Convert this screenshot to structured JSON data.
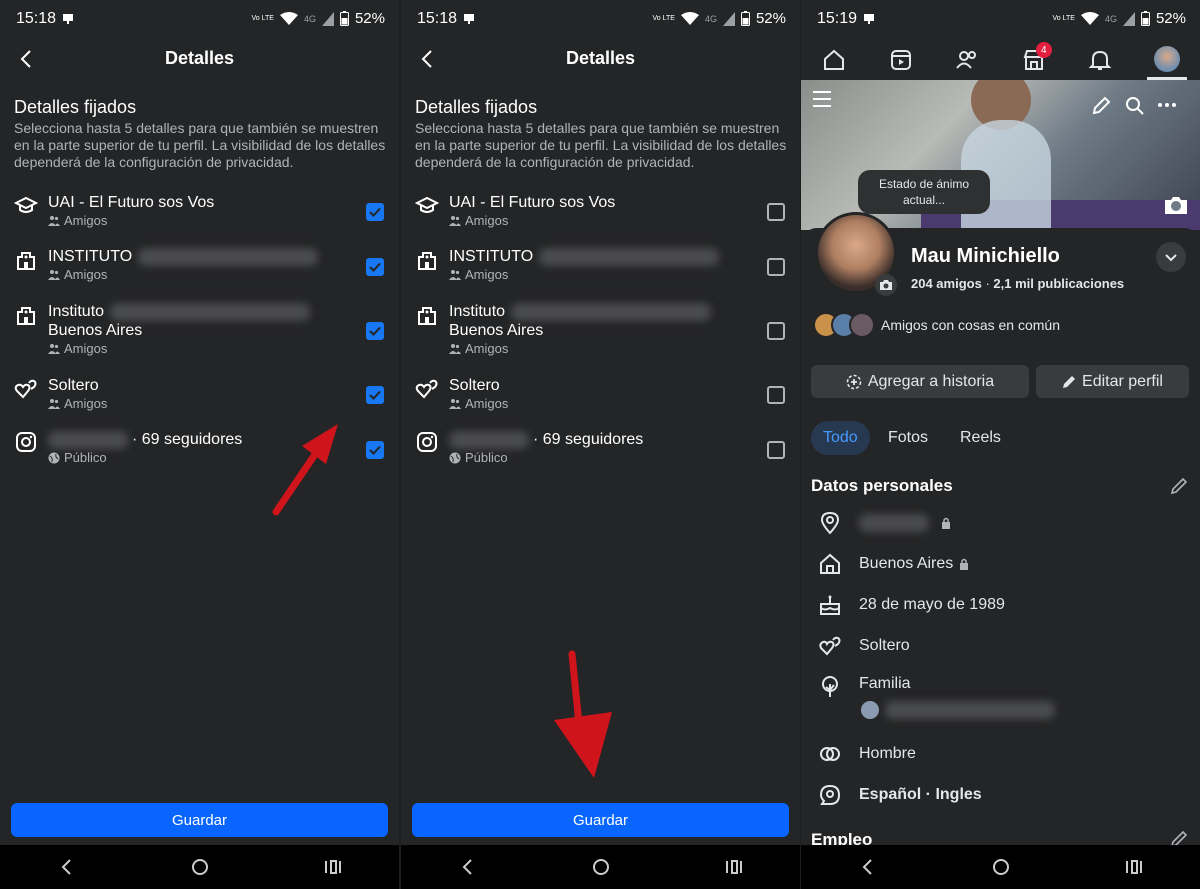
{
  "status": {
    "p1": {
      "time": "15:18",
      "volte": "Vo LTE",
      "net": "4G",
      "battery": "52%"
    },
    "p2": {
      "time": "15:18",
      "volte": "Vo LTE",
      "net": "4G",
      "battery": "52%"
    },
    "p3": {
      "time": "15:19",
      "volte": "Vo LTE",
      "net": "4G",
      "battery": "52%"
    }
  },
  "details": {
    "title": "Detalles",
    "section_title": "Detalles fijados",
    "description": "Selecciona hasta 5 detalles para que también se muestren en la parte superior de tu perfil. La visibilidad de los detalles dependerá de la configuración de privacidad.",
    "items": [
      {
        "icon": "graduation-cap-icon",
        "label": "UAI - El Futuro sos Vos",
        "audience": "Amigos",
        "audience_icon": "friends-icon"
      },
      {
        "icon": "building-icon",
        "label": "INSTITUTO",
        "audience": "Amigos",
        "audience_icon": "friends-icon"
      },
      {
        "icon": "building-icon",
        "label": "Instituto",
        "label_line2": "Buenos Aires",
        "audience": "Amigos",
        "audience_icon": "friends-icon"
      },
      {
        "icon": "hearts-icon",
        "label": "Soltero",
        "audience": "Amigos",
        "audience_icon": "friends-icon"
      },
      {
        "icon": "instagram-icon",
        "label": "· 69 seguidores",
        "audience": "Público",
        "audience_icon": "globe-icon"
      }
    ],
    "checked_panel1": [
      true,
      true,
      true,
      true,
      true
    ],
    "checked_panel2": [
      false,
      false,
      false,
      false,
      false
    ],
    "save_label": "Guardar"
  },
  "profile": {
    "tabs_badge": "4",
    "mood_bubble": "Estado de ánimo actual...",
    "name": "Mau Minichiello",
    "friends_count": "204 amigos",
    "publications": "2,1 mil publicaciones",
    "mutual_text": "Amigos con cosas en común",
    "add_story": "Agregar a historia",
    "edit_profile": "Editar perfil",
    "content_tabs": [
      "Todo",
      "Fotos",
      "Reels"
    ],
    "personal_title": "Datos personales",
    "personal": [
      {
        "icon": "location-pin-icon",
        "text": ""
      },
      {
        "icon": "home-icon",
        "text": "Buenos Aires"
      },
      {
        "icon": "cake-icon",
        "text": "28 de mayo de 1989"
      },
      {
        "icon": "hearts-icon",
        "text": "Soltero"
      },
      {
        "icon": "family-tree-icon",
        "text": "Familia"
      },
      {
        "icon": "gender-icon",
        "text": "Hombre"
      },
      {
        "icon": "language-icon",
        "text": "Español · Ingles"
      }
    ],
    "employment_title": "Empleo"
  },
  "colors": {
    "accent": "#0866ff",
    "checkbox": "#1877f2",
    "panel_bg": "#242526",
    "arrow": "#d0141b"
  }
}
